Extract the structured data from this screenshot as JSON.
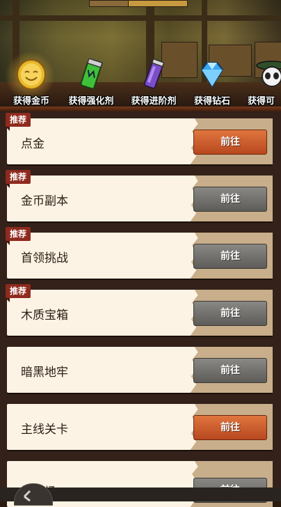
{
  "tabs": [
    {
      "label": "获得金币",
      "icon": "gold-coin-icon",
      "selected": true
    },
    {
      "label": "获得强化剂",
      "icon": "green-potion-icon",
      "selected": false
    },
    {
      "label": "获得进阶剂",
      "icon": "purple-potion-icon",
      "selected": false
    },
    {
      "label": "获得钻石",
      "icon": "diamond-icon",
      "selected": false
    },
    {
      "label": "获得可",
      "icon": "panda-hero-icon",
      "selected": false
    }
  ],
  "rows": [
    {
      "title": "点金",
      "tag": "推荐",
      "button": "前往",
      "button_style": "orange"
    },
    {
      "title": "金币副本",
      "tag": "推荐",
      "button": "前往",
      "button_style": "gray"
    },
    {
      "title": "首领挑战",
      "tag": "推荐",
      "button": "前往",
      "button_style": "gray"
    },
    {
      "title": "木质宝箱",
      "tag": "推荐",
      "button": "前往",
      "button_style": "gray"
    },
    {
      "title": "暗黑地牢",
      "tag": "",
      "button": "前往",
      "button_style": "gray"
    },
    {
      "title": "主线关卡",
      "tag": "",
      "button": "前往",
      "button_style": "orange"
    },
    {
      "title": "娱乐场",
      "tag": "",
      "button": "前往",
      "button_style": "gray"
    }
  ],
  "colors": {
    "tag": "#8f2a1e",
    "button_orange": "#c95a2a",
    "button_gray": "#6e6c68",
    "row_bg": "#fcf3e4"
  }
}
